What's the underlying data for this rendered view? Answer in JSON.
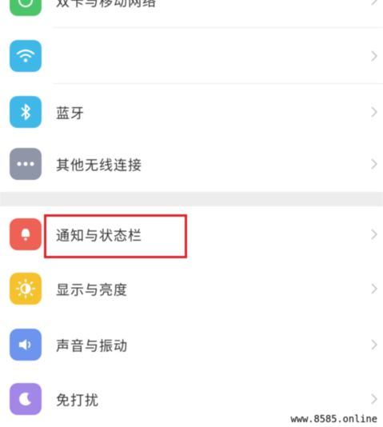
{
  "settings": {
    "items": [
      {
        "label": "双卡与移动网络",
        "icon": "mobile-network-icon",
        "color": "#4cc46a"
      },
      {
        "label": "",
        "icon": "wifi-icon",
        "color": "#3fb8e8"
      },
      {
        "label": "蓝牙",
        "icon": "bluetooth-icon",
        "color": "#3fb8e8"
      },
      {
        "label": "其他无线连接",
        "icon": "more-dots-icon",
        "color": "#8e96a8"
      },
      {
        "label": "通知与状态栏",
        "icon": "notification-icon",
        "color": "#ee6155"
      },
      {
        "label": "显示与亮度",
        "icon": "brightness-icon",
        "color": "#f5c22e"
      },
      {
        "label": "声音与振动",
        "icon": "speaker-icon",
        "color": "#6e95ee"
      },
      {
        "label": "免打扰",
        "icon": "moon-icon",
        "color": "#a287e6"
      }
    ]
  },
  "highlight_color": "#d9262c",
  "watermark": "www.8585.online"
}
